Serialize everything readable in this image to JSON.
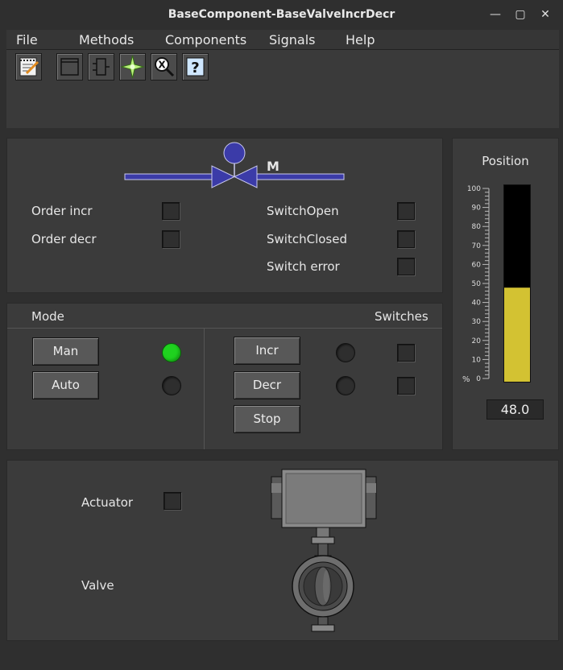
{
  "window": {
    "title": "BaseComponent-BaseValveIncrDecr",
    "controls": {
      "minimize": "—",
      "maximize": "▢",
      "close": "✕"
    }
  },
  "menu": [
    "File",
    "Methods",
    "Components",
    "Signals",
    "Help"
  ],
  "toolbar": {
    "items": [
      "notes-icon",
      "window-icon",
      "component-icon",
      "trace-icon",
      "crossref-icon",
      "help-icon"
    ],
    "help_glyph": "?",
    "crossref_glyph": "X"
  },
  "valve_symbol": {
    "motor_label": "M"
  },
  "signals": {
    "order_incr": "Order incr",
    "order_decr": "Order decr",
    "switch_open": "SwitchOpen",
    "switch_closed": "SwitchClosed",
    "switch_error": "Switch error"
  },
  "mode": {
    "title": "Mode",
    "switches_title": "Switches",
    "man": "Man",
    "auto": "Auto",
    "incr": "Incr",
    "decr": "Decr",
    "stop": "Stop",
    "man_active": true,
    "auto_active": false
  },
  "position": {
    "title": "Position",
    "value": 48.0,
    "display": "48.0",
    "unit": "%",
    "scale_min": 0,
    "scale_max": 100,
    "ticks": [
      "100",
      "90",
      "80",
      "70",
      "60",
      "50",
      "40",
      "30",
      "20",
      "10",
      "0"
    ]
  },
  "bottom": {
    "actuator": "Actuator",
    "valve": "Valve"
  },
  "colors": {
    "background": "#2f2f2f",
    "panel": "#3b3b3b",
    "symbol_blue": "#3b3ba8",
    "led_on": "#1fd21f",
    "bar_fill": "#d3c232"
  }
}
